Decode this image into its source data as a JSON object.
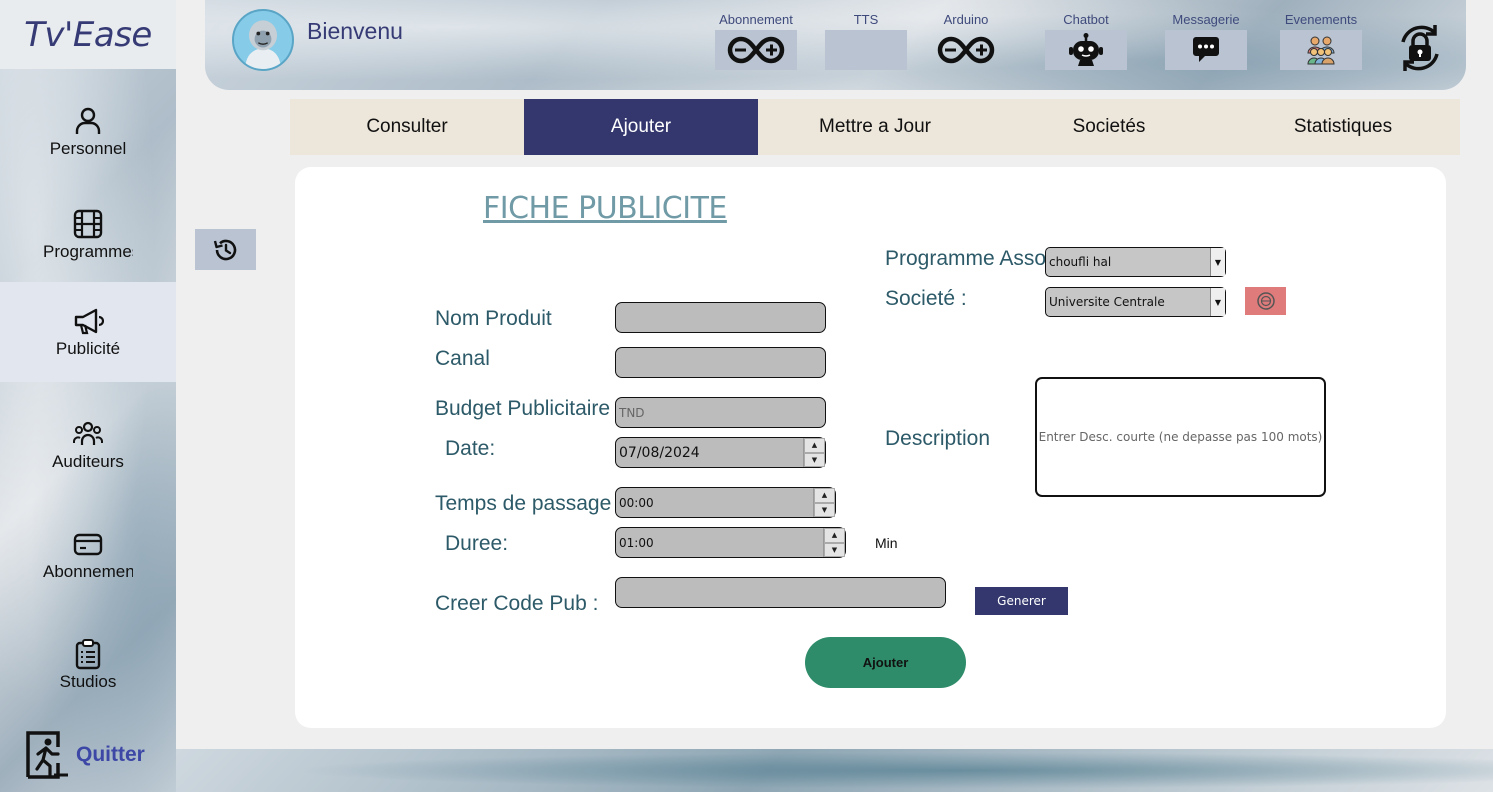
{
  "brand": {
    "name": "Tv'Ease"
  },
  "sidebar": {
    "items": [
      {
        "label": "Personnel",
        "icon": "person-icon"
      },
      {
        "label": "Programmes",
        "icon": "film-icon"
      },
      {
        "label": "Publicité",
        "icon": "megaphone-icon"
      },
      {
        "label": "Auditeurs",
        "icon": "users-icon"
      },
      {
        "label": "Abonnements",
        "icon": "card-icon"
      },
      {
        "label": "Studios",
        "icon": "clipboard-list-icon"
      }
    ],
    "quit_label": "Quitter"
  },
  "topbar": {
    "welcome": "Bienvenu",
    "nav": [
      {
        "label": "Abonnement",
        "icon": "arduino-icon"
      },
      {
        "label": "TTS",
        "icon": ""
      },
      {
        "label": "Arduino",
        "icon": "arduino-icon"
      },
      {
        "label": "Chatbot",
        "icon": "robot-icon"
      },
      {
        "label": "Messagerie",
        "icon": "chat-bubble-icon"
      },
      {
        "label": "Evenements",
        "icon": "group-icon"
      }
    ]
  },
  "tabs": [
    {
      "label": "Consulter",
      "active": false
    },
    {
      "label": "Ajouter",
      "active": true
    },
    {
      "label": "Mettre a Jour",
      "active": false
    },
    {
      "label": "Societés",
      "active": false
    },
    {
      "label": "Statistiques",
      "active": false
    }
  ],
  "form": {
    "title": "FICHE PUBLICITE ",
    "nom_produit": {
      "label": "Nom Produit",
      "value": ""
    },
    "canal": {
      "label": "Canal",
      "value": ""
    },
    "budget": {
      "label": "Budget Publicitaire",
      "placeholder": "TND"
    },
    "date": {
      "label": "Date:",
      "value": "07/08/2024"
    },
    "temps": {
      "label": "Temps de passage",
      "value": "00:00"
    },
    "duree": {
      "label": "Duree:",
      "value": "01:00",
      "unit": "Min"
    },
    "code": {
      "label": "Creer Code Pub :",
      "value": "",
      "button": "Generer"
    },
    "programme": {
      "label": "Programme Associé",
      "value": "choufli hal"
    },
    "societe": {
      "label": "Societé :",
      "value": "Universite Centrale"
    },
    "description": {
      "label": "Description",
      "placeholder": "Entrer Desc. courte (ne depasse pas 100 mots)"
    },
    "submit": "Ajouter"
  },
  "colors": {
    "accent": "#33376e",
    "tab_bar": "#ede6da",
    "label": "#2d5a68",
    "submit": "#2f8c6a",
    "danger": "#df7b7b"
  }
}
